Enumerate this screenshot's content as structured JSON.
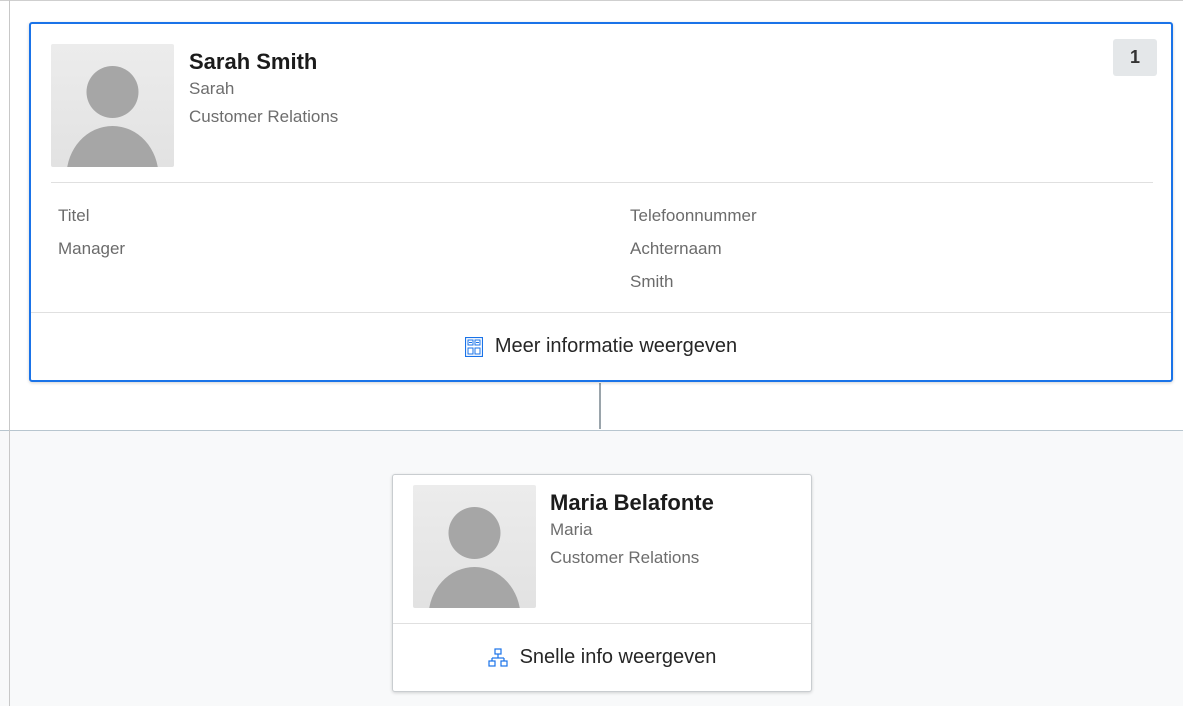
{
  "manager": {
    "name": "Sarah Smith",
    "nickname": "Sarah",
    "department": "Customer Relations",
    "subordinate_count": "1",
    "fields": {
      "title_label": "Titel",
      "title_value": "Manager",
      "phone_label": "Telefoonnummer",
      "lastname_label": "Achternaam",
      "lastname_value": "Smith"
    },
    "action_label": "Meer informatie weergeven",
    "action_icon": "form-icon"
  },
  "report": {
    "name": "Maria Belafonte",
    "nickname": "Maria",
    "department": "Customer Relations",
    "action_label": "Snelle info weergeven",
    "action_icon": "org-chart-icon"
  },
  "colors": {
    "selected_border": "#1a73e8",
    "icon_blue": "#1a73e8",
    "connector": "#9aa4ab"
  }
}
